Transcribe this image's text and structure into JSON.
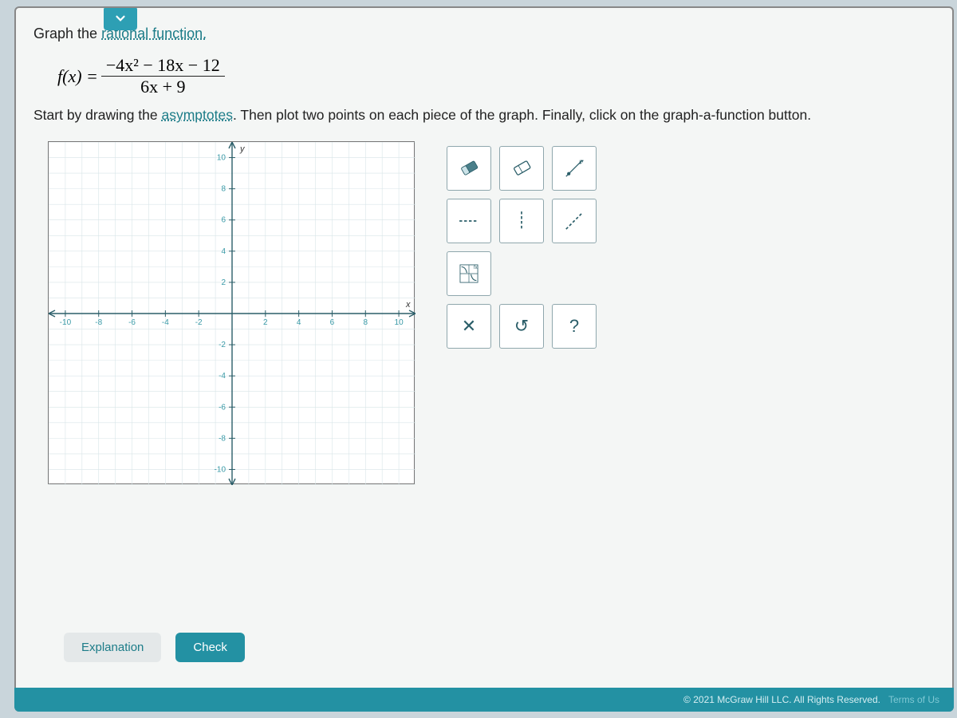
{
  "prompt": {
    "intro_a": "Graph the ",
    "link_a": "rational function.",
    "equation": {
      "lhs": "f(x) =",
      "numerator": "−4x² − 18x − 12",
      "denominator": "6x + 9"
    },
    "line2_a": "Start by drawing the ",
    "link_b": "asymptotes",
    "line2_b": ". Then plot two points on each piece of the graph. Finally, click on the graph-a-function button."
  },
  "chart_data": {
    "type": "scatter",
    "title": "",
    "xlabel": "x",
    "ylabel": "y",
    "xlim": [
      -11,
      11
    ],
    "ylim": [
      -11,
      11
    ],
    "x_ticks": [
      -10,
      -8,
      -6,
      -4,
      -2,
      2,
      4,
      6,
      8,
      10
    ],
    "y_ticks": [
      -10,
      -8,
      -6,
      -4,
      -2,
      2,
      4,
      6,
      8,
      10
    ],
    "series": []
  },
  "tools": {
    "row1": [
      "eraser-fill",
      "eraser-outline",
      "point-line"
    ],
    "row2": [
      "h-dash",
      "v-dash",
      "oblique-dash"
    ],
    "row3": [
      "graph-function",
      "",
      ""
    ],
    "row4_labels": [
      "✕",
      "↺",
      "?"
    ]
  },
  "buttons": {
    "explanation": "Explanation",
    "check": "Check"
  },
  "footer": {
    "copyright": "© 2021 McGraw Hill LLC. All Rights Reserved.",
    "terms": "Terms of Us"
  }
}
